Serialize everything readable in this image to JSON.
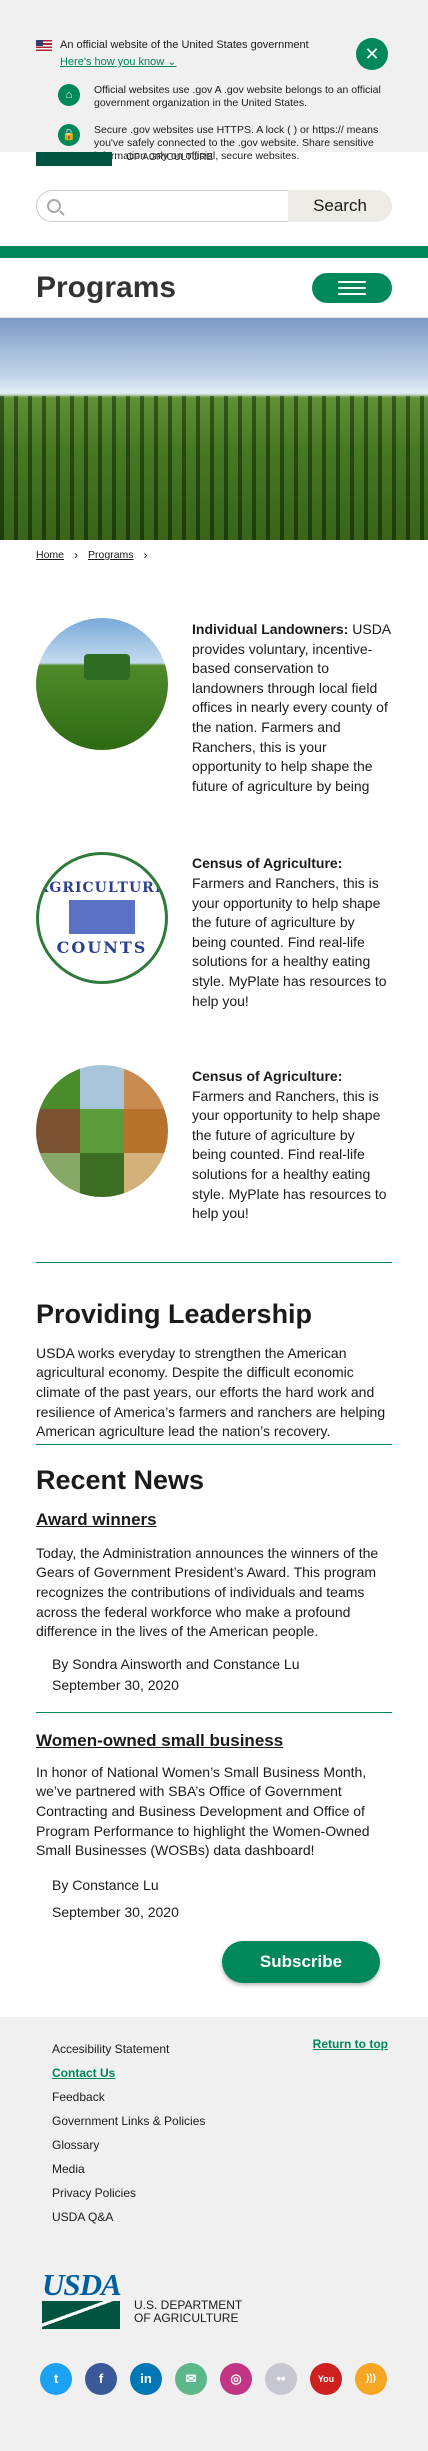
{
  "banner": {
    "official": "An official website of the United States government",
    "how": "Here's how you know",
    "gov_text": "Official websites use .gov A .gov website belongs to an official government organization in the United States.",
    "https_text": "Secure .gov websites use HTTPS. A lock ( ) or https:// means you've safely connected to the .gov website. Share sensitive information only on official, secure websites."
  },
  "header": {
    "agency_text": "OF AGRICULTURE",
    "search_placeholder": "",
    "search_label": "Search",
    "page_title": "Programs"
  },
  "breadcrumb": [
    {
      "label": "Home"
    },
    {
      "label": "Programs"
    }
  ],
  "programs": [
    {
      "title": "Individual Landowners:",
      "text": " USDA provides voluntary, incentive-based conservation to landowners through local field offices in nearly every county of the nation. Farmers and Ranchers, this is your opportunity to help shape the future of agriculture by being"
    },
    {
      "title": "Census of Agriculture:",
      "text": " Farmers and Ranchers, this is your opportunity to help shape the future of agriculture by being counted. Find real-life solutions for a healthy eating style. MyPlate has resources to help you!",
      "logo_top": "AGRICULTURE",
      "logo_bottom": "COUNTS"
    },
    {
      "title": "Census of Agriculture:",
      "text": " Farmers and Ranchers, this is your opportunity to help shape the future of agriculture by being counted. Find real-life solutions for a healthy eating style. MyPlate has resources to help you!"
    }
  ],
  "leadership": {
    "title": "Providing Leadership",
    "text": "USDA works everyday to strengthen the American agricultural economy. Despite the difficult economic climate of the past years, our efforts the hard work and resilience of America’s farmers and ranchers are helping American agriculture lead the nation’s recovery."
  },
  "news": {
    "title": "Recent News",
    "items": [
      {
        "title": "Award winners",
        "text": "Today, the Administration announces the winners of the Gears of Government President’s Award. This program recognizes the contributions of individuals and teams across the federal workforce who make a profound difference in the lives of the American people.",
        "byline": "By Sondra Ainsworth and Constance Lu",
        "date": "September 30, 2020"
      },
      {
        "title": "Women-owned small business",
        "text": "In honor of National Women’s Small Business Month, we’ve partnered with SBA’s Office of Government Contracting and Business Development and Office of Program Performance to highlight the Women-Owned Small Businesses (WOSBs) data dashboard!",
        "byline": "By Constance Lu",
        "date": "September 30, 2020"
      }
    ],
    "subscribe": "Subscribe"
  },
  "footer": {
    "links": [
      "Accesibility Statement",
      "Contact Us",
      "Feedback",
      "Government Links & Policies",
      "Glossary",
      "Media",
      "Privacy Policies",
      "USDA Q&A"
    ],
    "return_top": "Return to top",
    "logo_letters": "USDA",
    "dept_line1": "U.S. DEPARTMENT",
    "dept_line2": "OF AGRICULTURE",
    "social": [
      {
        "icon": "twitter-icon",
        "glyph": "t",
        "color": "#1da1f2"
      },
      {
        "icon": "facebook-icon",
        "glyph": "f",
        "color": "#3b5998"
      },
      {
        "icon": "linkedin-icon",
        "glyph": "in",
        "color": "#0077b5"
      },
      {
        "icon": "email-icon",
        "glyph": "✉",
        "color": "#5cb88b"
      },
      {
        "icon": "instagram-icon",
        "glyph": "◎",
        "color": "#c13584"
      },
      {
        "icon": "flickr-icon",
        "glyph": "••",
        "color": "#c7c7d2"
      },
      {
        "icon": "youtube-icon",
        "glyph": "You",
        "color": "#cd201f"
      },
      {
        "icon": "rss-icon",
        "glyph": ")))",
        "color": "#f5a623"
      }
    ]
  }
}
